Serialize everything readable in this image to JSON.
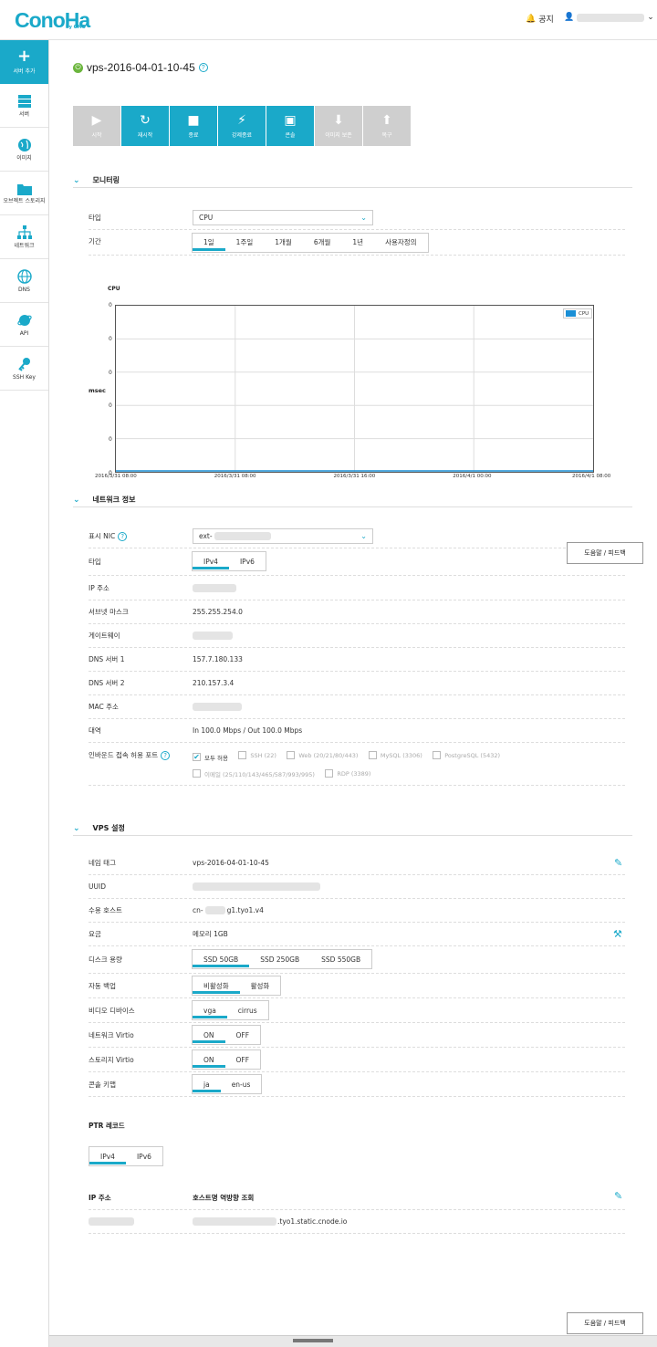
{
  "header": {
    "logo": "ConoHa",
    "logo_sub": "by GMO",
    "notice_label": "공지"
  },
  "sidebar": {
    "add_label": "서버 추가",
    "items": [
      {
        "label": "서버",
        "icon": "server-icon"
      },
      {
        "label": "이미지",
        "icon": "globe-icon"
      },
      {
        "label": "오브젝트 스토리지",
        "icon": "folder-icon"
      },
      {
        "label": "네트워크",
        "icon": "network-icon"
      },
      {
        "label": "DNS",
        "icon": "dns-globe-icon"
      },
      {
        "label": "API",
        "icon": "api-icon"
      },
      {
        "label": "SSH Key",
        "icon": "key-icon"
      }
    ]
  },
  "server": {
    "name": "vps-2016-04-01-10-45",
    "status_color": "#6bb53d"
  },
  "actions": [
    {
      "label": "시작",
      "icon": "▶",
      "enabled": false
    },
    {
      "label": "재시작",
      "icon": "↻",
      "enabled": true
    },
    {
      "label": "종료",
      "icon": "■",
      "enabled": true
    },
    {
      "label": "강제종료",
      "icon": "⚡",
      "enabled": true
    },
    {
      "label": "콘솔",
      "icon": "▣",
      "enabled": true
    },
    {
      "label": "이미지 보존",
      "icon": "⬇",
      "enabled": false
    },
    {
      "label": "복구",
      "icon": "⬆",
      "enabled": false
    }
  ],
  "monitoring": {
    "title": "모니터링",
    "type_label": "타입",
    "type_value": "CPU",
    "period_label": "기간",
    "periods": [
      "1일",
      "1주일",
      "1개월",
      "6개월",
      "1년",
      "사용자정의"
    ],
    "period_active": 0
  },
  "chart_data": {
    "type": "line",
    "title": "CPU",
    "ylabel": "msec",
    "xlabel": "",
    "x_ticks": [
      "2016/3/31 08:00",
      "2016/3/31 08:00",
      "2016/3/31 16:00",
      "2016/4/1 00:00",
      "2016/4/1 08:00"
    ],
    "y_ticks": [
      "0",
      "0",
      "0",
      "0",
      "0",
      "0"
    ],
    "series": [
      {
        "name": "CPU",
        "values": [
          0,
          0,
          0,
          0,
          0
        ]
      }
    ],
    "ylim": [
      0,
      0
    ],
    "grid": true,
    "legend": "top-right",
    "series_color": "#1a8fd6"
  },
  "network": {
    "title": "네트워크 정보",
    "nic_label": "표시 NIC",
    "nic_value": "ext-",
    "type_label": "타입",
    "type_options": [
      "IPv4",
      "IPv6"
    ],
    "ip_label": "IP 주소",
    "subnet_label": "서브넷 마스크",
    "subnet_value": "255.255.254.0",
    "gateway_label": "게이트웨이",
    "dns1_label": "DNS 서버 1",
    "dns1_value": "157.7.180.133",
    "dns2_label": "DNS 서버 2",
    "dns2_value": "210.157.3.4",
    "mac_label": "MAC 주소",
    "bandwidth_label": "대역",
    "bandwidth_value": "In 100.0 Mbps / Out 100.0 Mbps",
    "ports_label": "인바운드 접속 허용 포트",
    "ports": [
      {
        "label": "모두 허용",
        "checked": true
      },
      {
        "label": "SSH (22)",
        "checked": false
      },
      {
        "label": "Web (20/21/80/443)",
        "checked": false
      },
      {
        "label": "MySQL (3306)",
        "checked": false
      },
      {
        "label": "PostgreSQL (5432)",
        "checked": false
      },
      {
        "label": "이메일 (25/110/143/465/587/993/995)",
        "checked": false
      },
      {
        "label": "RDP (3389)",
        "checked": false
      }
    ]
  },
  "feedback_label": "도움말 / 피드백",
  "vps": {
    "title": "VPS 설정",
    "name_tag_label": "네임 태그",
    "name_tag_value": "vps-2016-04-01-10-45",
    "uuid_label": "UUID",
    "host_label": "수용 호스트",
    "host_prefix": "cn-",
    "host_suffix": "g1.tyo1.v4",
    "plan_label": "요금",
    "plan_value": "메모리 1GB",
    "disk_label": "디스크 용량",
    "disk_options": [
      "SSD 50GB",
      "SSD 250GB",
      "SSD 550GB"
    ],
    "backup_label": "자동 백업",
    "backup_options": [
      "비활성화",
      "활성화"
    ],
    "video_label": "비디오 디바이스",
    "video_options": [
      "vga",
      "cirrus"
    ],
    "net_virtio_label": "네트워크 Virtio",
    "net_virtio_options": [
      "ON",
      "OFF"
    ],
    "storage_virtio_label": "스토리지 Virtio",
    "storage_virtio_options": [
      "ON",
      "OFF"
    ],
    "keymap_label": "콘솔 키맵",
    "keymap_options": [
      "ja",
      "en-us"
    ]
  },
  "ptr": {
    "title": "PTR 레코드",
    "options": [
      "IPv4",
      "IPv6"
    ],
    "ip_header": "IP 주소",
    "host_header": "호스트명 역방향 조회",
    "host_suffix": ".tyo1.static.cnode.io"
  }
}
